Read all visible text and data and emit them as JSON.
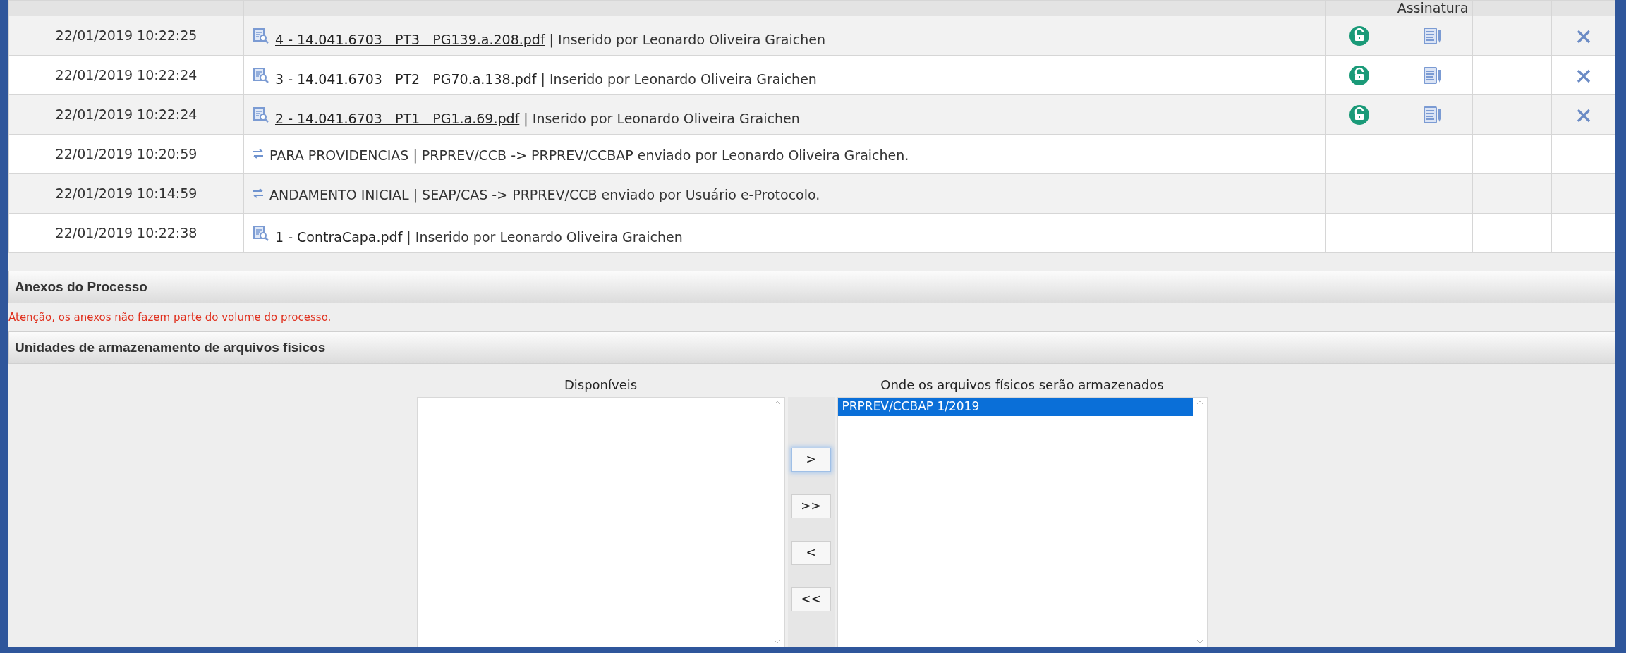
{
  "history_table": {
    "signature_column_label": "Assinatura",
    "rows": [
      {
        "datetime": "22/01/2019 10:22:25",
        "kind": "document",
        "link": "4 - 14.041.6703   PT3   PG139.a.208.pdf",
        "text": " | Inserido por Leonardo Oliveira Graichen",
        "actions_shown": true
      },
      {
        "datetime": "22/01/2019 10:22:24",
        "kind": "document",
        "link": "3 - 14.041.6703   PT2   PG70.a.138.pdf",
        "text": " | Inserido por Leonardo Oliveira Graichen",
        "actions_shown": true
      },
      {
        "datetime": "22/01/2019 10:22:24",
        "kind": "document",
        "link": "2 - 14.041.6703   PT1   PG1.a.69.pdf",
        "text": " | Inserido por Leonardo Oliveira Graichen",
        "actions_shown": true
      },
      {
        "datetime": "22/01/2019 10:20:59",
        "kind": "transfer",
        "text": "PARA PROVIDENCIAS | PRPREV/CCB -> PRPREV/CCBAP enviado por Leonardo Oliveira Graichen.",
        "actions_shown": false
      },
      {
        "datetime": "22/01/2019 10:14:59",
        "kind": "transfer",
        "text": "ANDAMENTO INICIAL | SEAP/CAS -> PRPREV/CCB enviado por Usuário e-Protocolo.",
        "actions_shown": false
      },
      {
        "datetime": "22/01/2019 10:22:38",
        "kind": "document",
        "link": "1 - ContraCapa.pdf",
        "text": " | Inserido por Leonardo Oliveira Graichen",
        "actions_shown": false
      }
    ]
  },
  "attachments": {
    "title": "Anexos do Processo",
    "warning": "Atenção, os anexos não fazem parte do volume do processo."
  },
  "storage": {
    "title": "Unidades de armazenamento de arquivos físicos",
    "available": {
      "label": "Disponíveis"
    },
    "buttons": [
      {
        "label": ">",
        "focused": true
      },
      {
        "label": ">>",
        "focused": false
      },
      {
        "label": "<",
        "focused": false
      },
      {
        "label": "<<",
        "focused": false
      }
    ],
    "assigned": {
      "label": "Onde os arquivos físicos serão armazenados",
      "items": [
        {
          "label": "PRPREV/CCBAP 1/2019",
          "selected": true
        }
      ]
    }
  }
}
